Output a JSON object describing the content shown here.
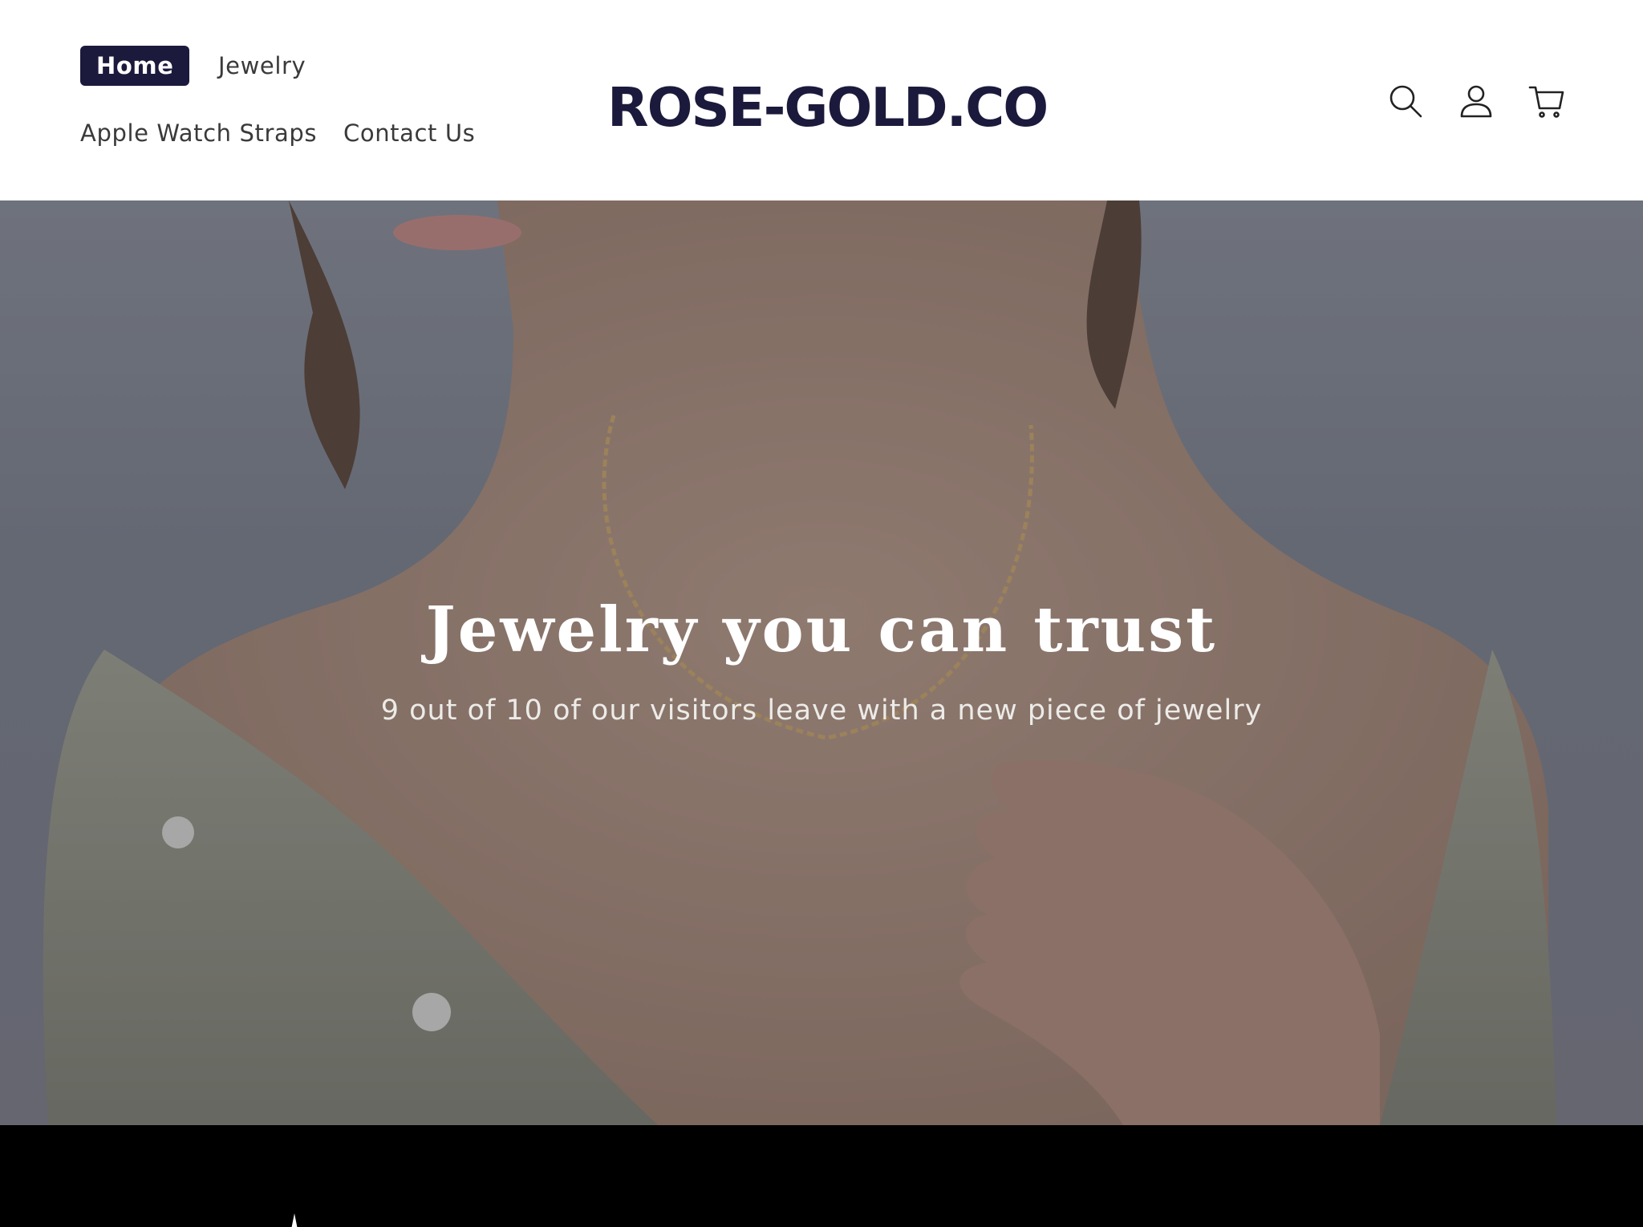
{
  "header": {
    "nav": {
      "home": "Home",
      "jewelry": "Jewelry",
      "apple_watch_straps": "Apple Watch Straps",
      "contact_us": "Contact Us"
    },
    "logo_text": "ROSE-GOLD.CO",
    "icons": [
      "search-icon",
      "account-icon",
      "cart-icon"
    ]
  },
  "hero": {
    "title": "Jewelry you can trust",
    "subtitle": "9 out of 10 of our visitors leave with a new piece of jewelry"
  },
  "colors": {
    "brand": "#1b1a3c",
    "footer": "#000000",
    "hero_text": "#ffffff"
  }
}
